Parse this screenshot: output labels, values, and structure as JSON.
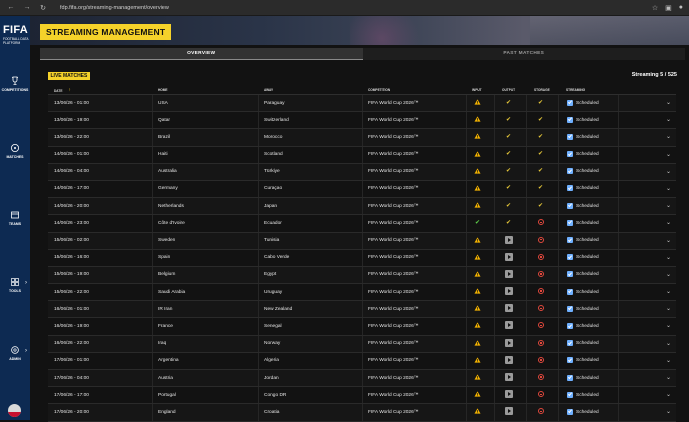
{
  "browser": {
    "url": "fdp.fifa.org/streaming-management/overview"
  },
  "sidebar": {
    "logo": "FIFA",
    "logo_sub": "FOOTBALL DATA PLATFORM",
    "items": [
      {
        "label": "COMPETITIONS",
        "icon": "trophy-icon"
      },
      {
        "label": "MATCHES",
        "icon": "ball-icon"
      },
      {
        "label": "TEAMS",
        "icon": "team-icon"
      },
      {
        "label": "TOOLS",
        "icon": "tools-icon"
      },
      {
        "label": "ADMIN",
        "icon": "gear-icon"
      }
    ]
  },
  "header": {
    "title": "STREAMING MANAGEMENT"
  },
  "tabs": [
    {
      "label": "OVERVIEW"
    },
    {
      "label": "PAST MATCHES"
    }
  ],
  "live": {
    "badge": "LIVE MATCHES",
    "streaming_count": "Streaming 5 / 525"
  },
  "columns": {
    "date": "DATE",
    "home": "HOME",
    "away": "AWAY",
    "competition": "COMPETITION",
    "input": "INPUT",
    "output": "OUTPUT",
    "storage": "STORAGE",
    "streaming": "STREAMING"
  },
  "status_colors": {
    "warning": "#f5b400",
    "ok": "#e8c93a",
    "ok_green": "#5fd04a",
    "error": "#e0483d",
    "checkbox": "#6fb0ff"
  },
  "rows": [
    {
      "date": "13/06/26 - 01:00",
      "home": "USA",
      "away": "Paraguay",
      "competition": "FIFA World Cup 2026™",
      "input": "warning",
      "output": "ok",
      "storage": "ok",
      "streaming": "Scheduled"
    },
    {
      "date": "13/06/26 - 19:00",
      "home": "Qatar",
      "away": "Switzerland",
      "competition": "FIFA World Cup 2026™",
      "input": "warning",
      "output": "ok",
      "storage": "ok",
      "streaming": "Scheduled"
    },
    {
      "date": "13/06/26 - 22:00",
      "home": "Brazil",
      "away": "Morocco",
      "competition": "FIFA World Cup 2026™",
      "input": "warning",
      "output": "ok",
      "storage": "ok",
      "streaming": "Scheduled"
    },
    {
      "date": "14/06/26 - 01:00",
      "home": "Haiti",
      "away": "Scotland",
      "competition": "FIFA World Cup 2026™",
      "input": "warning",
      "output": "ok",
      "storage": "ok",
      "streaming": "Scheduled"
    },
    {
      "date": "14/06/26 - 04:00",
      "home": "Australia",
      "away": "Türkiye",
      "competition": "FIFA World Cup 2026™",
      "input": "warning",
      "output": "ok",
      "storage": "ok",
      "streaming": "Scheduled"
    },
    {
      "date": "14/06/26 - 17:00",
      "home": "Germany",
      "away": "Curaçao",
      "competition": "FIFA World Cup 2026™",
      "input": "warning",
      "output": "ok",
      "storage": "ok",
      "streaming": "Scheduled"
    },
    {
      "date": "14/06/26 - 20:00",
      "home": "Netherlands",
      "away": "Japan",
      "competition": "FIFA World Cup 2026™",
      "input": "warning",
      "output": "ok",
      "storage": "ok",
      "streaming": "Scheduled"
    },
    {
      "date": "14/06/26 - 23:00",
      "home": "Côte d'Ivoire",
      "away": "Ecuador",
      "competition": "FIFA World Cup 2026™",
      "input": "ok_green",
      "output": "ok",
      "storage": "error",
      "streaming": "Scheduled"
    },
    {
      "date": "15/06/26 - 02:00",
      "home": "Sweden",
      "away": "Tunisia",
      "competition": "FIFA World Cup 2026™",
      "input": "warning",
      "output": "play",
      "storage": "error",
      "streaming": "Scheduled"
    },
    {
      "date": "15/06/26 - 16:00",
      "home": "Spain",
      "away": "Cabo Verde",
      "competition": "FIFA World Cup 2026™",
      "input": "warning",
      "output": "play",
      "storage": "error",
      "streaming": "Scheduled"
    },
    {
      "date": "15/06/26 - 19:00",
      "home": "Belgium",
      "away": "Egypt",
      "competition": "FIFA World Cup 2026™",
      "input": "warning",
      "output": "play",
      "storage": "error",
      "streaming": "Scheduled"
    },
    {
      "date": "15/06/26 - 22:00",
      "home": "Saudi Arabia",
      "away": "Uruguay",
      "competition": "FIFA World Cup 2026™",
      "input": "warning",
      "output": "play",
      "storage": "error",
      "streaming": "Scheduled"
    },
    {
      "date": "16/06/26 - 01:00",
      "home": "IR Iran",
      "away": "New Zealand",
      "competition": "FIFA World Cup 2026™",
      "input": "warning",
      "output": "play",
      "storage": "error",
      "streaming": "Scheduled"
    },
    {
      "date": "16/06/26 - 19:00",
      "home": "France",
      "away": "Senegal",
      "competition": "FIFA World Cup 2026™",
      "input": "warning",
      "output": "play",
      "storage": "error",
      "streaming": "Scheduled"
    },
    {
      "date": "16/06/26 - 22:00",
      "home": "Iraq",
      "away": "Norway",
      "competition": "FIFA World Cup 2026™",
      "input": "warning",
      "output": "play",
      "storage": "error",
      "streaming": "Scheduled"
    },
    {
      "date": "17/06/26 - 01:00",
      "home": "Argentina",
      "away": "Algeria",
      "competition": "FIFA World Cup 2026™",
      "input": "warning",
      "output": "play",
      "storage": "error",
      "streaming": "Scheduled"
    },
    {
      "date": "17/06/26 - 04:00",
      "home": "Austria",
      "away": "Jordan",
      "competition": "FIFA World Cup 2026™",
      "input": "warning",
      "output": "play",
      "storage": "error",
      "streaming": "Scheduled"
    },
    {
      "date": "17/06/26 - 17:00",
      "home": "Portugal",
      "away": "Congo DR",
      "competition": "FIFA World Cup 2026™",
      "input": "warning",
      "output": "play",
      "storage": "error",
      "streaming": "Scheduled"
    },
    {
      "date": "17/06/26 - 20:00",
      "home": "England",
      "away": "Croatia",
      "competition": "FIFA World Cup 2026™",
      "input": "warning",
      "output": "play",
      "storage": "error",
      "streaming": "Scheduled"
    }
  ]
}
